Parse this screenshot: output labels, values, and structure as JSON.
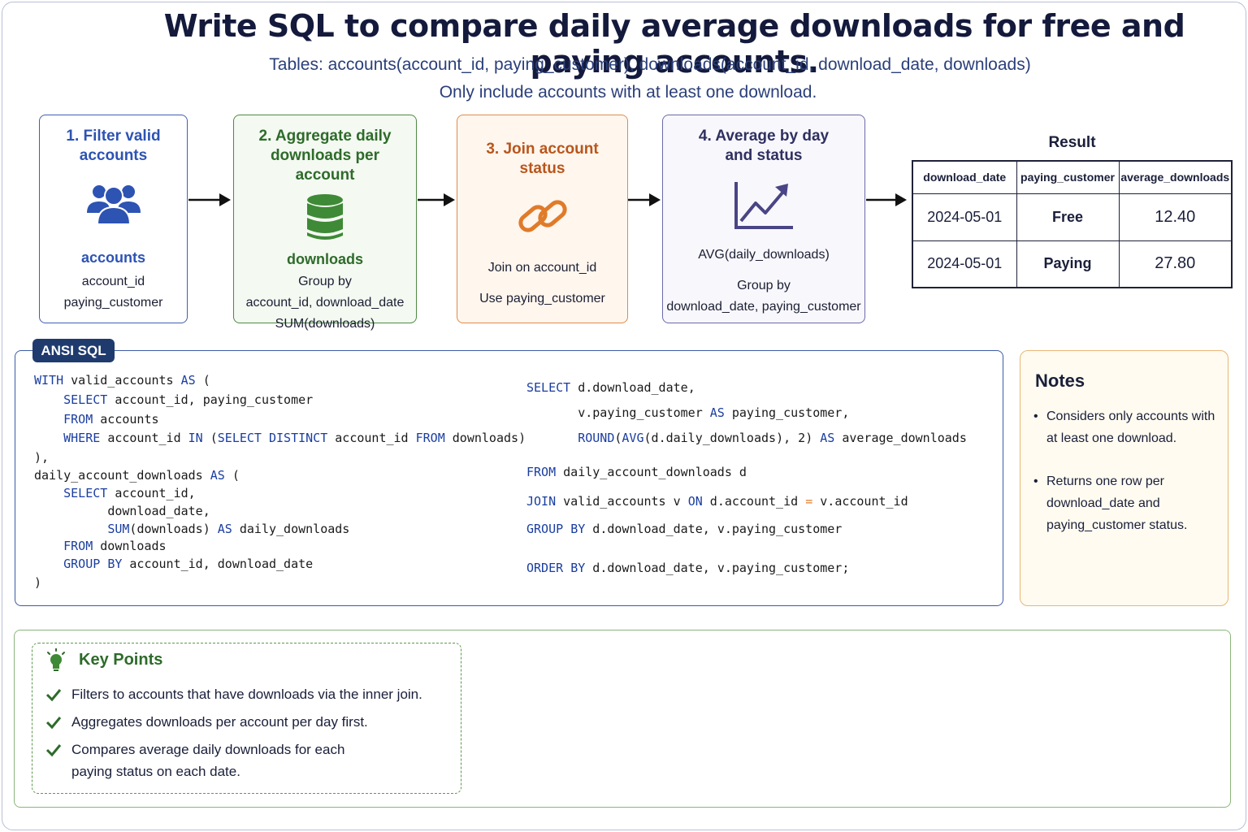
{
  "title": "Write SQL to compare daily average downloads for free and paying accounts.",
  "subtitle_tables": "Tables: accounts(account_id, paying_customer), downloads(account_id, download_date, downloads)",
  "subtitle_filter": "Only include accounts with at least one download.",
  "steps": [
    {
      "title_l1": "1. Filter valid",
      "title_l2": "accounts",
      "label": "accounts",
      "lines": [
        "account_id",
        "paying_customer"
      ],
      "icon": "users-icon",
      "color": "#2d53b3"
    },
    {
      "title_l1": "2. Aggregate daily",
      "title_l2": "downloads per account",
      "label": "downloads",
      "lines": [
        "Group by",
        "account_id, download_date",
        "SUM(downloads)"
      ],
      "icon": "database-icon",
      "color": "#3e7a2e"
    },
    {
      "title_l1": "3. Join account status",
      "lines": [
        "Join on account_id",
        "Use paying_customer"
      ],
      "icon": "link-icon",
      "color": "#b9561b"
    },
    {
      "title_l1": "4. Average by day",
      "title_l2": "and status",
      "lines": [
        "AVG(daily_downloads)",
        "Group by",
        "download_date, paying_customer"
      ],
      "icon": "trend-chart-icon",
      "color": "#3e3a7e"
    }
  ],
  "result": {
    "title": "Result",
    "headers": [
      "download_date",
      "paying_customer",
      "average_downloads"
    ],
    "rows": [
      [
        "2024-05-01",
        "Free",
        "12.40"
      ],
      [
        "2024-05-01",
        "Paying",
        "27.80"
      ]
    ]
  },
  "sql": {
    "tag": "ANSI SQL",
    "left": [
      "WITH valid_accounts AS (",
      "    SELECT account_id, paying_customer",
      "    FROM accounts",
      "    WHERE account_id IN (SELECT DISTINCT account_id FROM downloads)",
      "),",
      "daily_account_downloads AS (",
      "    SELECT account_id,",
      "          download_date,",
      "          SUM(downloads) AS daily_downloads",
      "    FROM downloads",
      "    GROUP BY account_id, download_date",
      ")"
    ],
    "right": [
      "SELECT d.download_date,",
      "       v.paying_customer AS paying_customer,",
      "       ROUND(AVG(d.daily_downloads), 2) AS average_downloads",
      "FROM daily_account_downloads d",
      "JOIN valid_accounts v ON d.account_id = v.account_id",
      "GROUP BY d.download_date, v.paying_customer",
      "ORDER BY d.download_date, v.paying_customer;"
    ]
  },
  "notes": {
    "title": "Notes",
    "items": [
      "Considers only accounts with at least one download.",
      "Returns one row per download_date and paying_customer status."
    ]
  },
  "key_points": {
    "title": "Key Points",
    "items": [
      "Filters to accounts that have downloads via the inner join.",
      "Aggregates downloads per account per day first.",
      "Compares average daily downloads for each paying status on each date."
    ]
  }
}
